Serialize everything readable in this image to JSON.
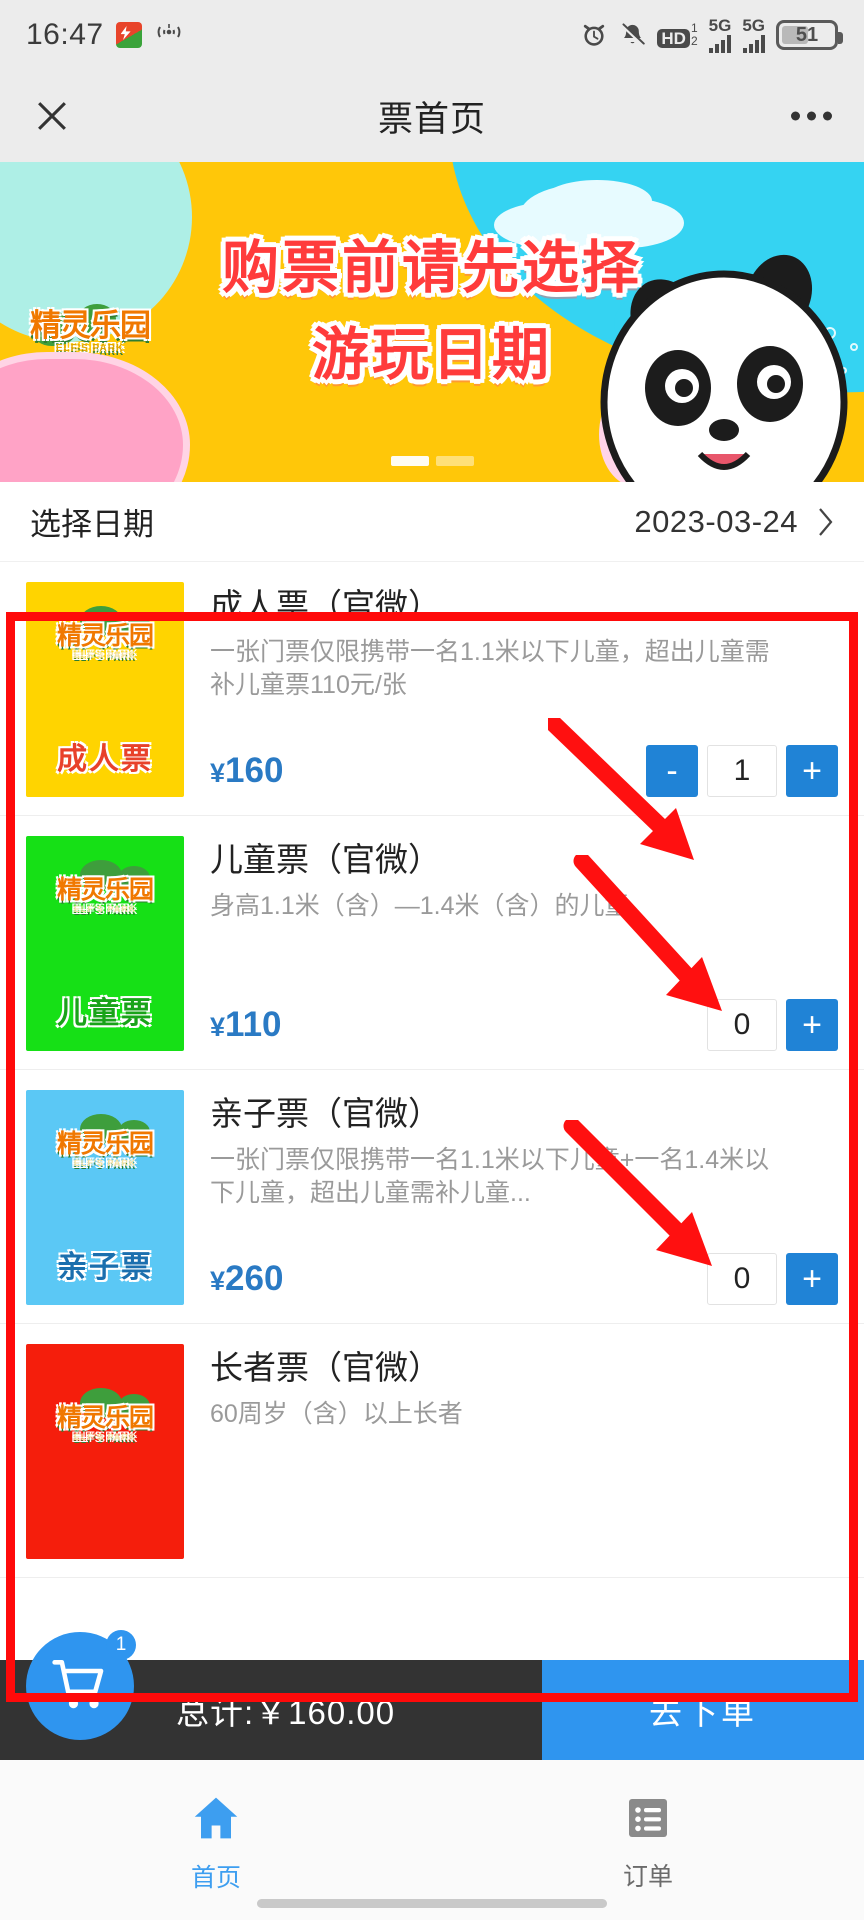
{
  "status_bar": {
    "time": "16:47",
    "app_icon": "wps-icon",
    "cast_icon": "screencast-icon",
    "alarm_icon": "alarm-clock-icon",
    "mute_icon": "bell-muted-icon",
    "hd_label": "HD",
    "hd_sup": "1",
    "hd_sub": "2",
    "signal1_label": "5G",
    "signal2_label": "5G",
    "battery_percent": "51"
  },
  "navbar": {
    "title": "票首页",
    "close_icon": "close-icon",
    "more_icon": "more-options-icon"
  },
  "banner": {
    "logo_text": "精灵乐园",
    "logo_sub": "ELF'S PARK",
    "headline_line1": "购票前请先选择",
    "headline_line2": "游玩日期",
    "dots": [
      "active",
      "inactive"
    ]
  },
  "date_row": {
    "label": "选择日期",
    "value": "2023-03-24",
    "chevron_icon": "chevron-right-icon"
  },
  "tickets": [
    {
      "name": "成人票（官微）",
      "desc": "一张门票仅限携带一名1.1米以下儿童，超出儿童需补儿童票110元/张",
      "price": "160",
      "currency": "¥",
      "quantity": "1",
      "has_minus": true,
      "minus_label": "-",
      "plus_label": "+",
      "thumb_bg": "#FFD400",
      "thumb_name": "成人票",
      "thumb_name_color": "#E8412A"
    },
    {
      "name": "儿童票（官微）",
      "desc": "身高1.1米（含）—1.4米（含）的儿童",
      "price": "110",
      "currency": "¥",
      "quantity": "0",
      "has_minus": false,
      "minus_label": "-",
      "plus_label": "+",
      "thumb_bg": "#16E016",
      "thumb_name": "儿童票",
      "thumb_name_color": "#19A319"
    },
    {
      "name": "亲子票（官微）",
      "desc": "一张门票仅限携带一名1.1米以下儿童+一名1.4米以下儿童，超出儿童需补儿童...",
      "price": "260",
      "currency": "¥",
      "quantity": "0",
      "has_minus": false,
      "minus_label": "-",
      "plus_label": "+",
      "thumb_bg": "#5BC8F5",
      "thumb_name": "亲子票",
      "thumb_name_color": "#1B6FAE"
    },
    {
      "name": "长者票（官微）",
      "desc": "60周岁（含）以上长者",
      "price": "",
      "currency": "",
      "quantity": "",
      "has_minus": false,
      "minus_label": "-",
      "plus_label": "+",
      "thumb_bg": "#F51E0C",
      "thumb_name": "",
      "thumb_name_color": "#ffffff"
    }
  ],
  "cart_bar": {
    "cart_icon": "shopping-cart-icon",
    "badge_count": "1",
    "total_text": "总计:￥160.00",
    "order_button": "去下单"
  },
  "tab_bar": {
    "items": [
      {
        "label": "首页",
        "icon": "home-icon",
        "active": true
      },
      {
        "label": "订单",
        "icon": "order-list-icon",
        "active": false
      }
    ]
  },
  "annotations": {
    "box_color": "#FF0A0A",
    "arrow_color": "#FF1010",
    "arrow_count": 3
  }
}
